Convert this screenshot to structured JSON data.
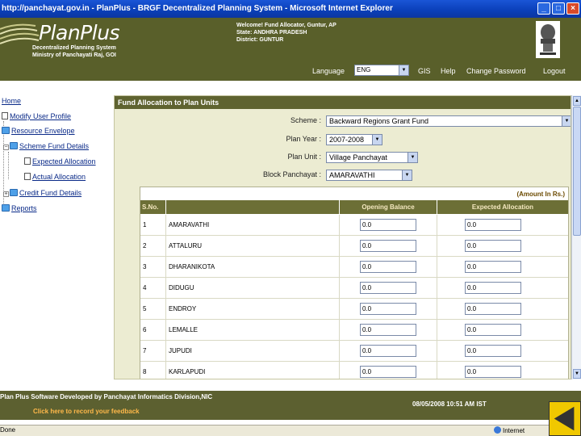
{
  "window": {
    "title": "http://panchayat.gov.in - PlanPlus - BRGF Decentralized Planning System - Microsoft Internet Explorer",
    "minimize": "_",
    "maximize": "□",
    "close": "×"
  },
  "header": {
    "logo": "PlanPlus",
    "sub1": "Decentralized Planning System",
    "sub2": "Ministry of Panchayati Raj, GOI",
    "welcome_line1": "Welcome! Fund Allocator, Guntur, AP",
    "welcome_line2": "State: ANDHRA PRADESH",
    "welcome_line3": "District: GUNTUR"
  },
  "menu": {
    "language_label": "Language",
    "language_value": "ENG",
    "gis": "GIS",
    "help": "Help",
    "change_password": "Change Password",
    "logout": "Logout"
  },
  "nav": {
    "home": "Home",
    "modify_profile": "Modify User Profile",
    "resource_envelope": "Resource Envelope",
    "scheme_fund_details": "Scheme Fund Details",
    "expected_allocation": "Expected Allocation",
    "actual_allocation": "Actual Allocation",
    "credit_fund_details": "Credit Fund Details",
    "reports": "Reports"
  },
  "panel": {
    "title": "Fund Allocation to Plan Units",
    "scheme_label": "Scheme :",
    "scheme_value": "Backward Regions Grant Fund",
    "plan_year_label": "Plan Year :",
    "plan_year_value": "2007-2008",
    "plan_unit_label": "Plan Unit :",
    "plan_unit_value": "Village Panchayat",
    "block_label": "Block Panchayat :",
    "block_value": "AMARAVATHI",
    "amount_note": "(Amount In Rs.)",
    "columns": [
      "S.No.",
      "",
      "Opening Balance",
      "Expected Allocation"
    ],
    "rows": [
      {
        "sno": "1",
        "name": "AMARAVATHI",
        "opening": "0.0",
        "expected": "0.0"
      },
      {
        "sno": "2",
        "name": "ATTALURU",
        "opening": "0.0",
        "expected": "0.0"
      },
      {
        "sno": "3",
        "name": "DHARANIKOTA",
        "opening": "0.0",
        "expected": "0.0"
      },
      {
        "sno": "4",
        "name": "DIDUGU",
        "opening": "0.0",
        "expected": "0.0"
      },
      {
        "sno": "5",
        "name": "ENDROY",
        "opening": "0.0",
        "expected": "0.0"
      },
      {
        "sno": "6",
        "name": "LEMALLE",
        "opening": "0.0",
        "expected": "0.0"
      },
      {
        "sno": "7",
        "name": "JUPUDI",
        "opening": "0.0",
        "expected": "0.0"
      },
      {
        "sno": "8",
        "name": "KARLAPUDI",
        "opening": "0.0",
        "expected": "0.0"
      }
    ]
  },
  "footer": {
    "line1": "Plan Plus Software Developed by Panchayat Informatics Division,NIC",
    "feedback": "Click here to record your feedback",
    "datetime": "08/05/2008 10:51 AM IST"
  },
  "status": {
    "done": "Done",
    "zone": "Internet"
  }
}
